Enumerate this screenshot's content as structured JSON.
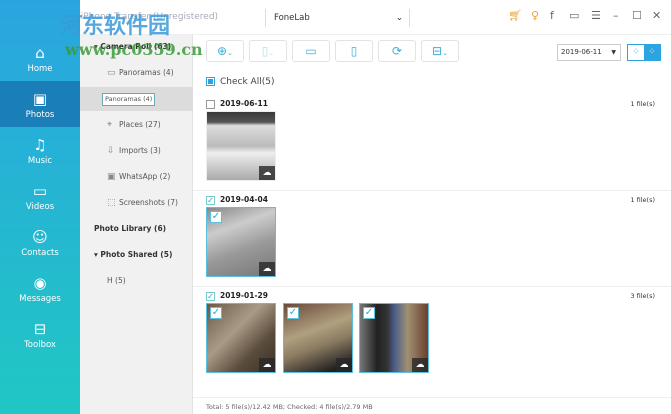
{
  "title": {
    "app": "FoneLab iPhone Transfer (Unregistered)",
    "device": "FoneLab"
  },
  "watermark": {
    "text": "河东软件园",
    "url": "www.pc0359.cn"
  },
  "nav": [
    {
      "label": "Home",
      "icon": "home-icon"
    },
    {
      "label": "Photos",
      "icon": "photos-icon"
    },
    {
      "label": "Music",
      "icon": "music-icon"
    },
    {
      "label": "Videos",
      "icon": "videos-icon"
    },
    {
      "label": "Contacts",
      "icon": "contacts-icon"
    },
    {
      "label": "Messages",
      "icon": "messages-icon"
    },
    {
      "label": "Toolbox",
      "icon": "toolbox-icon"
    }
  ],
  "albums": {
    "camera_roll": "Camera Roll (63)",
    "panoramas": "Panoramas (4)",
    "tooltip": "Panoramas (4)",
    "places": "Places (27)",
    "imports": "Imports (3)",
    "whatsapp": "WhatsApp (2)",
    "screenshots": "Screenshots (7)",
    "photo_library": "Photo Library (6)",
    "photo_shared": "Photo Shared (5)",
    "h": "H (5)"
  },
  "date_filter": "2019-06-11",
  "check_all": "Check All(5)",
  "sections": [
    {
      "date": "2019-06-11",
      "count": "1 file(s)",
      "checked": false
    },
    {
      "date": "2019-04-04",
      "count": "1 file(s)",
      "checked": true
    },
    {
      "date": "2019-01-29",
      "count": "3 file(s)",
      "checked": true
    }
  ],
  "footer": "Total: 5 file(s)/12.42 MB; Checked: 4 file(s)/2.79 MB",
  "accent": "#2aa5e0"
}
